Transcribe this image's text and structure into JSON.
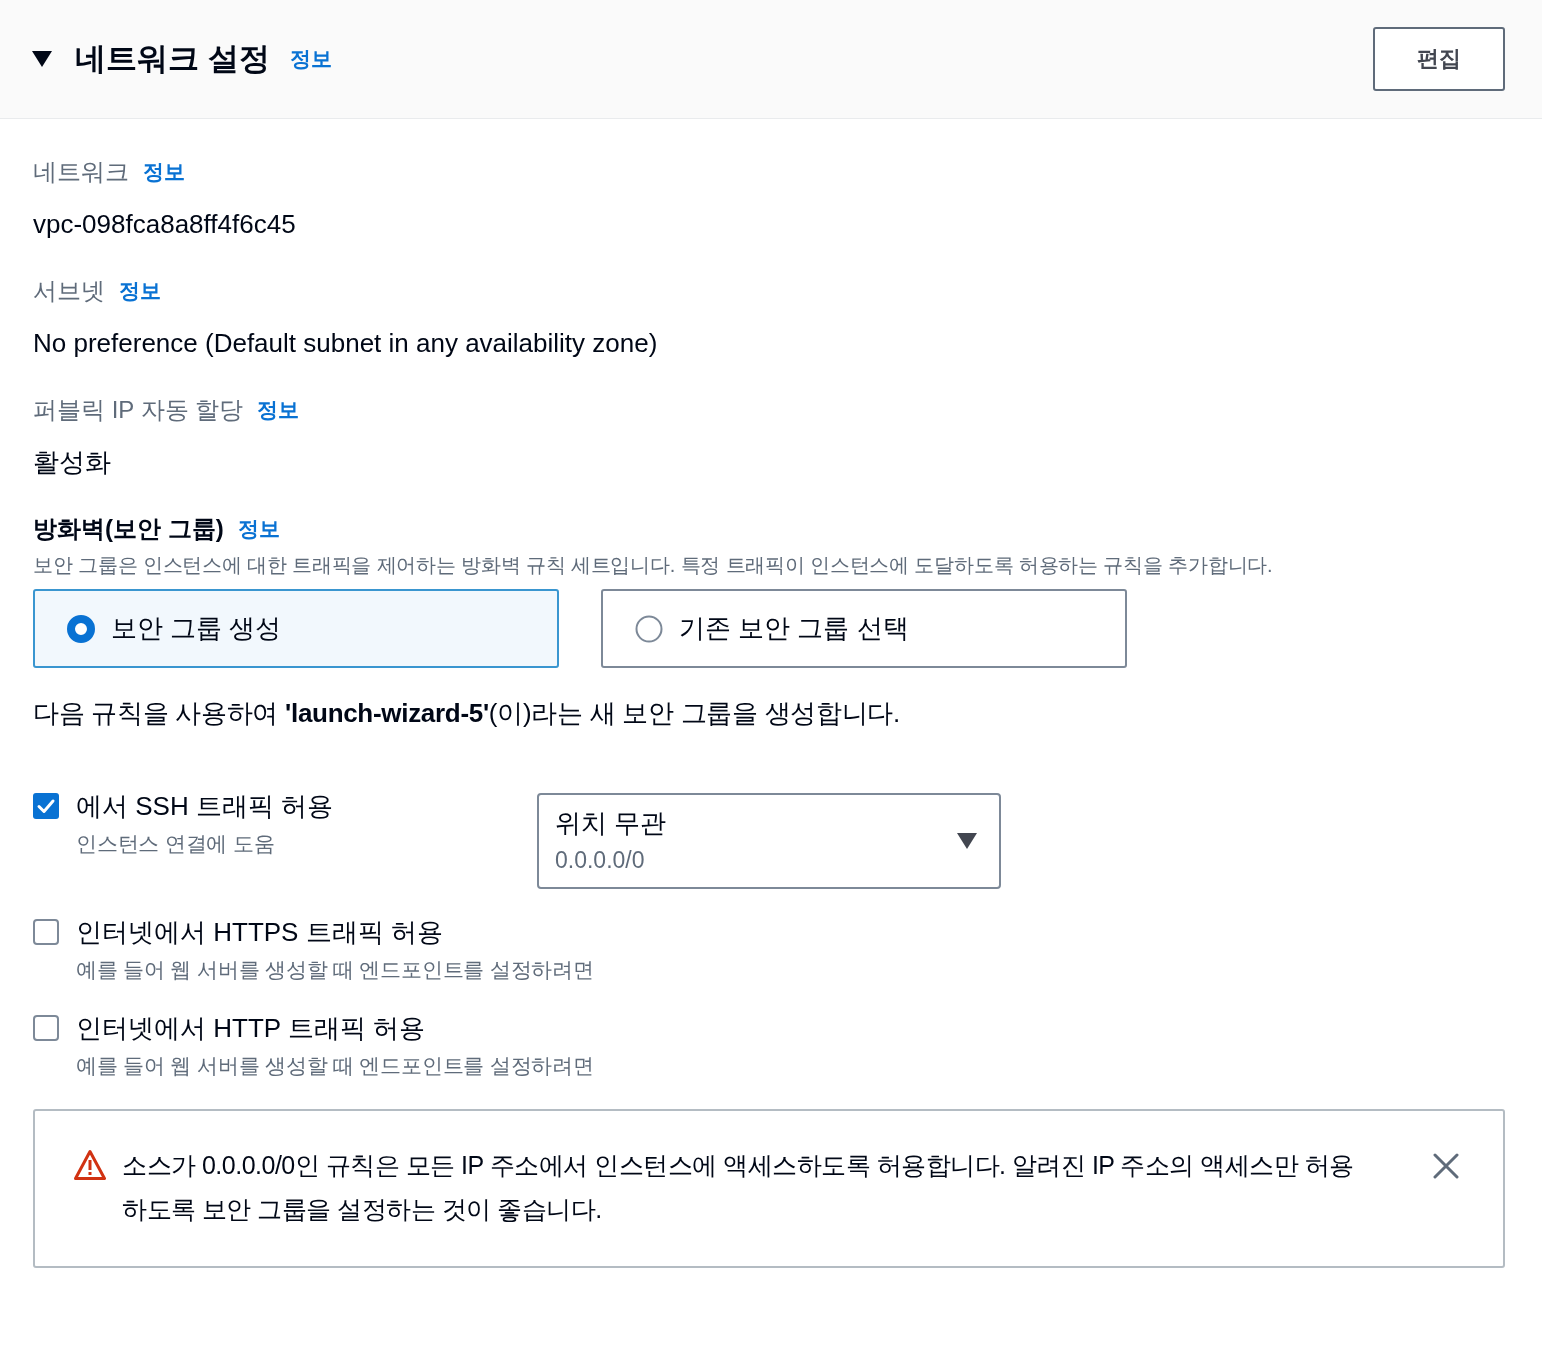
{
  "section": {
    "title": "네트워크 설정",
    "expanded": true,
    "info_link": "정보",
    "edit_button": "편집"
  },
  "fields": [
    {
      "label": "네트워크",
      "info_link": "정보",
      "value": "vpc-098fca8a8ff4f6c45"
    },
    {
      "label": "서브넷",
      "info_link": "정보",
      "value": "No preference (Default subnet in any availability zone)"
    },
    {
      "label": "퍼블릭 IP 자동 할당",
      "info_link": "정보",
      "value": "활성화"
    }
  ],
  "firewall": {
    "label": "방화벽(보안 그룹)",
    "info_link": "정보",
    "description": "보안 그룹은 인스턴스에 대한 트래픽을 제어하는 방화벽 규칙 세트입니다. 특정 트래픽이 인스턴스에 도달하도록 허용하는 규칙을 추가합니다.",
    "options": [
      {
        "label": "보안 그룹 생성",
        "selected": true
      },
      {
        "label": "기존 보안 그룹 선택",
        "selected": false
      }
    ],
    "summary": "다음 규칙을 사용하여 **'launch-wizard-5'**(이)라는 새 보안 그룹을 생성합니다."
  },
  "rules": [
    {
      "label": "에서 SSH 트래픽 허용",
      "description": "인스턴스 연결에 도움",
      "checked": true,
      "source_select": {
        "value": "위치 무관",
        "detail": "0.0.0.0/0"
      }
    },
    {
      "label": "인터넷에서 HTTPS 트래픽 허용",
      "description": "예를 들어 웹 서버를 생성할 때 엔드포인트를 설정하려면",
      "checked": false
    },
    {
      "label": "인터넷에서 HTTP 트래픽 허용",
      "description": "예를 들어 웹 서버를 생성할 때 엔드포인트를 설정하려면",
      "checked": false
    }
  ],
  "alert": {
    "kind": "warning",
    "message": "소스가 0.0.0.0/0인 규칙은 모든 IP 주소에서 인스턴스에 액세스하도록 허용합니다. 알려진 IP 주소의 액세스만 허용하도록 보안 그룹을 설정하는 것이 좋습니다."
  }
}
